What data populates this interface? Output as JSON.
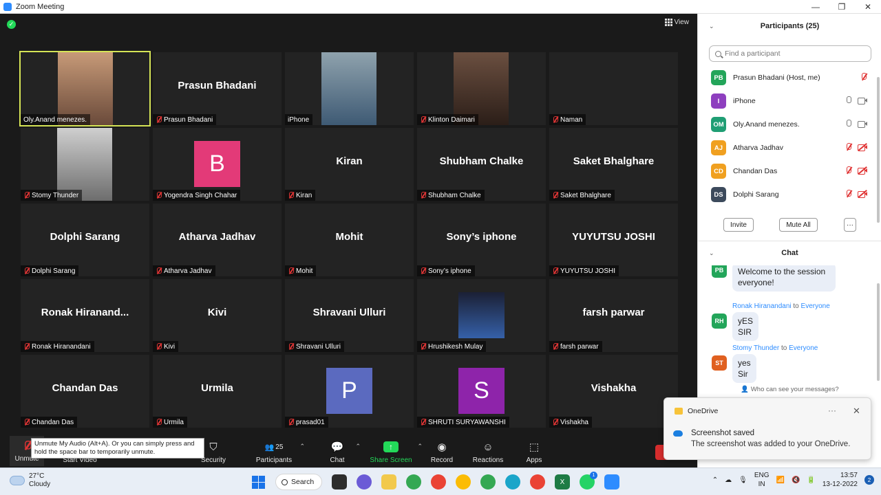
{
  "window": {
    "title": "Zoom Meeting",
    "minimize": "—",
    "maximize": "❐",
    "close": "✕"
  },
  "stage": {
    "view_label": "View"
  },
  "tiles": [
    {
      "name": "Oly.Anand menezes.",
      "muted": false,
      "video": true,
      "active": true
    },
    {
      "name": "Prasun Bhadani",
      "display": "Prasun Bhadani",
      "muted": true
    },
    {
      "name": "iPhone",
      "muted": false,
      "video": true
    },
    {
      "name": "Klinton Daimari",
      "muted": true,
      "video": true
    },
    {
      "name": "Naman",
      "muted": true
    },
    {
      "name": "Stomy Thunder",
      "muted": true,
      "video": true
    },
    {
      "name": "Yogendra Singh Chahar",
      "muted": true,
      "avatar": "B",
      "avatar_color": "#e33a78"
    },
    {
      "name": "Kiran",
      "display": "Kiran",
      "muted": true
    },
    {
      "name": "Shubham Chalke",
      "display": "Shubham Chalke",
      "muted": true
    },
    {
      "name": "Saket Bhalghare",
      "display": "Saket Bhalghare",
      "muted": true
    },
    {
      "name": "Dolphi Sarang",
      "display": "Dolphi Sarang",
      "muted": true
    },
    {
      "name": "Atharva Jadhav",
      "display": "Atharva Jadhav",
      "muted": true
    },
    {
      "name": "Mohit",
      "display": "Mohit",
      "muted": true
    },
    {
      "name": "Sony’s iphone",
      "display": "Sony’s iphone",
      "muted": true
    },
    {
      "name": "YUYUTSU JOSHI",
      "display": "YUYUTSU JOSHI",
      "muted": true
    },
    {
      "name": "Ronak Hiranandani",
      "display": "Ronak Hiranand...",
      "muted": true
    },
    {
      "name": "Kivi",
      "display": "Kivi",
      "muted": true
    },
    {
      "name": "Shravani Ulluri",
      "display": "Shravani Ulluri",
      "muted": true
    },
    {
      "name": "Hrushikesh Mulay",
      "muted": true,
      "video": true
    },
    {
      "name": "farsh parwar",
      "display": "farsh parwar",
      "muted": true
    },
    {
      "name": "Chandan Das",
      "display": "Chandan Das",
      "muted": true
    },
    {
      "name": "Urmila",
      "display": "Urmila",
      "muted": true
    },
    {
      "name": "prasad01",
      "muted": true,
      "avatar": "P",
      "avatar_color": "#5b6abf"
    },
    {
      "name": "SHRUTI SURYAWANSHI",
      "muted": true,
      "avatar": "S",
      "avatar_color": "#8e24aa"
    },
    {
      "name": "Vishakha",
      "display": "Vishakha",
      "muted": true
    }
  ],
  "toolbar": {
    "unmute": "Unmute",
    "start_video": "Start Video",
    "security": "Security",
    "participants": "Participants",
    "participants_count": "25",
    "chat": "Chat",
    "share_screen": "Share Screen",
    "record": "Record",
    "reactions": "Reactions",
    "apps": "Apps",
    "tooltip": "Unmute My Audio (Alt+A). Or you can simply press and hold the space bar to temporarily unmute."
  },
  "participants_panel": {
    "title": "Participants (25)",
    "search_placeholder": "Find a participant",
    "items": [
      {
        "initials": "PB",
        "name": "Prasun Bhadani (Host, me)",
        "color": "#23a55a",
        "mic": "off",
        "cam": "none"
      },
      {
        "initials": "I",
        "name": "iPhone",
        "color": "#8e3fbf",
        "mic": "on",
        "cam": "on"
      },
      {
        "initials": "OM",
        "name": "Oly.Anand menezes.",
        "color": "#1f9e74",
        "mic": "on",
        "cam": "on"
      },
      {
        "initials": "AJ",
        "name": "Atharva Jadhav",
        "color": "#f0a020",
        "mic": "off",
        "cam": "off"
      },
      {
        "initials": "CD",
        "name": "Chandan Das",
        "color": "#f0a020",
        "mic": "off",
        "cam": "off"
      },
      {
        "initials": "DS",
        "name": "Dolphi Sarang",
        "color": "#3c4a5c",
        "mic": "off",
        "cam": "off"
      }
    ],
    "invite": "Invite",
    "mute_all": "Mute All",
    "more": "···"
  },
  "chat_panel": {
    "title": "Chat",
    "to_word": "to",
    "messages": [
      {
        "initials": "PB",
        "color": "#23a55a",
        "text": "Welcome to the session everyone!"
      },
      {
        "initials": "RH",
        "color": "#23a55a",
        "from": "Ronak Hiranandani",
        "to": "Everyone",
        "text": "yES SIR"
      },
      {
        "initials": "ST",
        "color": "#e06020",
        "from": "Stomy Thunder",
        "to": "Everyone",
        "text": "yes Sir"
      }
    ],
    "who_can_see": "Who can see your messages?"
  },
  "toast": {
    "app": "OneDrive",
    "heading": "Screenshot saved",
    "body": "The screenshot was added to your OneDrive.",
    "more": "···",
    "close": "✕"
  },
  "taskbar": {
    "temp": "27°C",
    "condition": "Cloudy",
    "search": "Search",
    "lang1": "ENG",
    "lang2": "IN",
    "time": "13:57",
    "date": "13-12-2022",
    "notifications": "2",
    "whatsapp_badge": "1"
  }
}
